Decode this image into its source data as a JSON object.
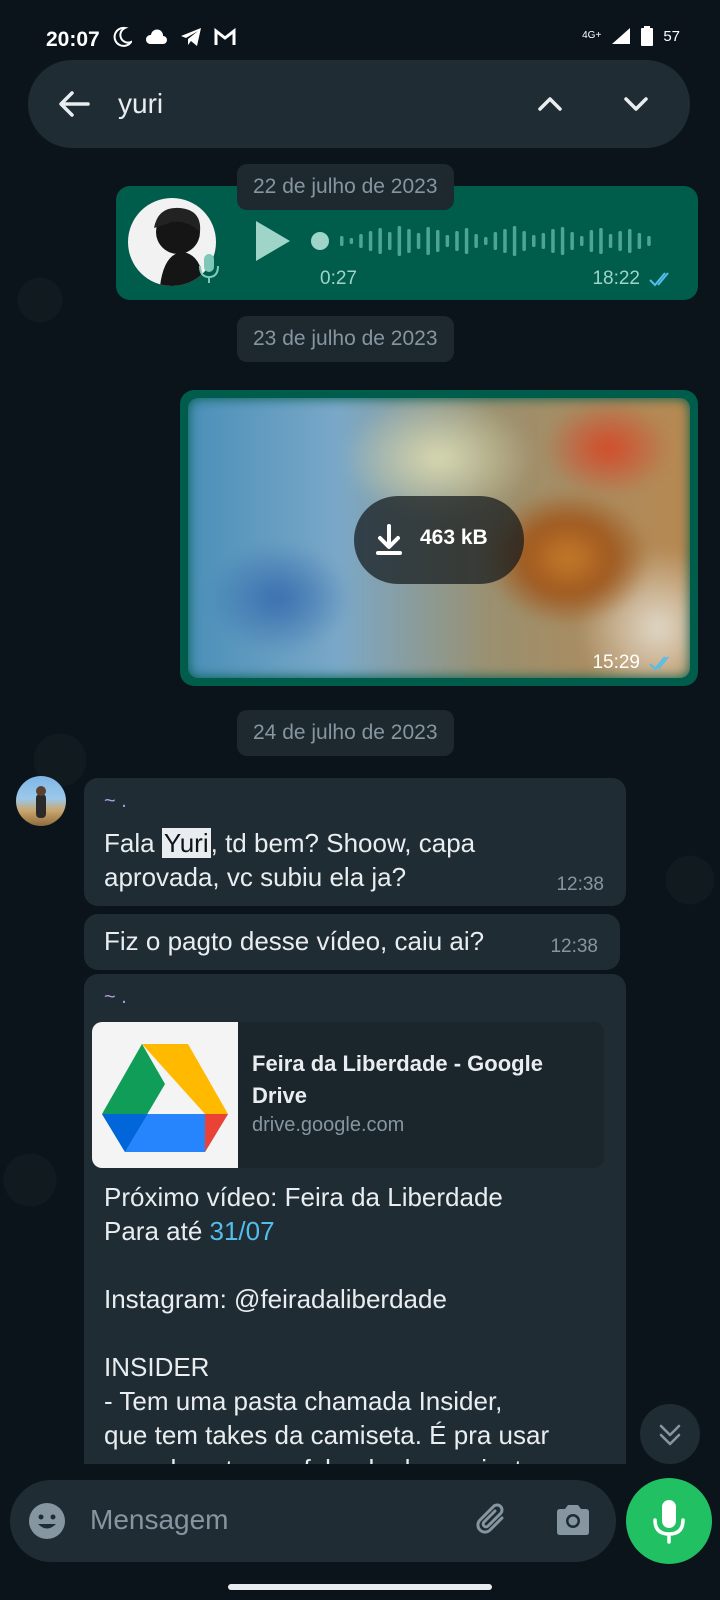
{
  "status_bar": {
    "time": "20:07",
    "network": "4G+",
    "battery": "57"
  },
  "search": {
    "query": "yuri"
  },
  "dates": {
    "d1": "22 de julho de 2023",
    "d2": "23 de julho de 2023",
    "d3": "24 de julho de 2023"
  },
  "voice_message": {
    "duration": "0:27",
    "time": "18:22"
  },
  "image_message": {
    "size": "463 kB",
    "time": "15:29"
  },
  "msg1": {
    "sender": "~ .",
    "text_before": "Fala ",
    "highlight": "Yuri",
    "text_after_line1": ", td bem? Shoow, capa",
    "text_line2": "aprovada, vc subiu ela ja?",
    "time": "12:38"
  },
  "msg2": {
    "text": "Fiz o pagto desse vídeo, caiu ai?",
    "time": "12:38"
  },
  "msg3": {
    "sender": "~ .",
    "link_title": "Feira da Liberdade - Google Drive",
    "link_domain": "drive.google.com",
    "line1": "Próximo vídeo: Feira da Liberdade",
    "line2_prefix": "Para até ",
    "line2_date": "31/07",
    "line3": "Instagram: @feiradaliberdade",
    "line4": "INSIDER",
    "line5": "- Tem uma pasta chamada Insider,",
    "line6": "que tem takes da camiseta. É pra usar",
    "line7": "quando estamos falando da camiseta"
  },
  "composer": {
    "placeholder": "Mensagem"
  },
  "colors": {
    "background": "#0b141a",
    "outgoing_bubble": "#005c4b",
    "incoming_bubble": "#1f2c34",
    "accent_green": "#21c063",
    "tick_blue": "#53bdeb"
  }
}
